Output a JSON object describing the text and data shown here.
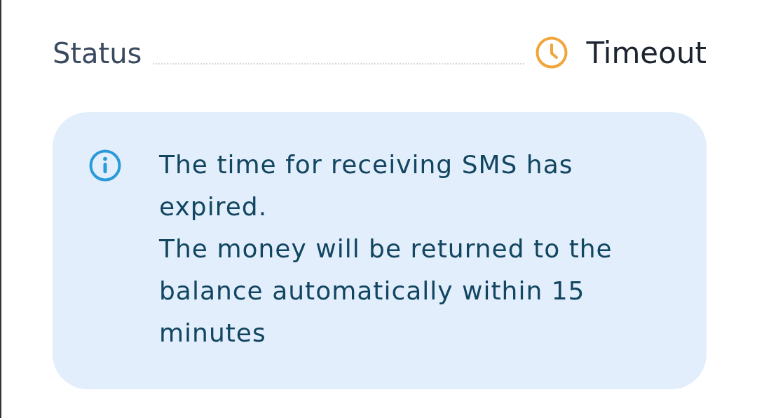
{
  "status_row": {
    "label": "Status",
    "value": "Timeout",
    "kind": "timeout"
  },
  "notice": {
    "paragraphs": [
      "The time for receiving SMS has expired.",
      "The money will be returned to the balance automatically within 15 minutes"
    ]
  }
}
